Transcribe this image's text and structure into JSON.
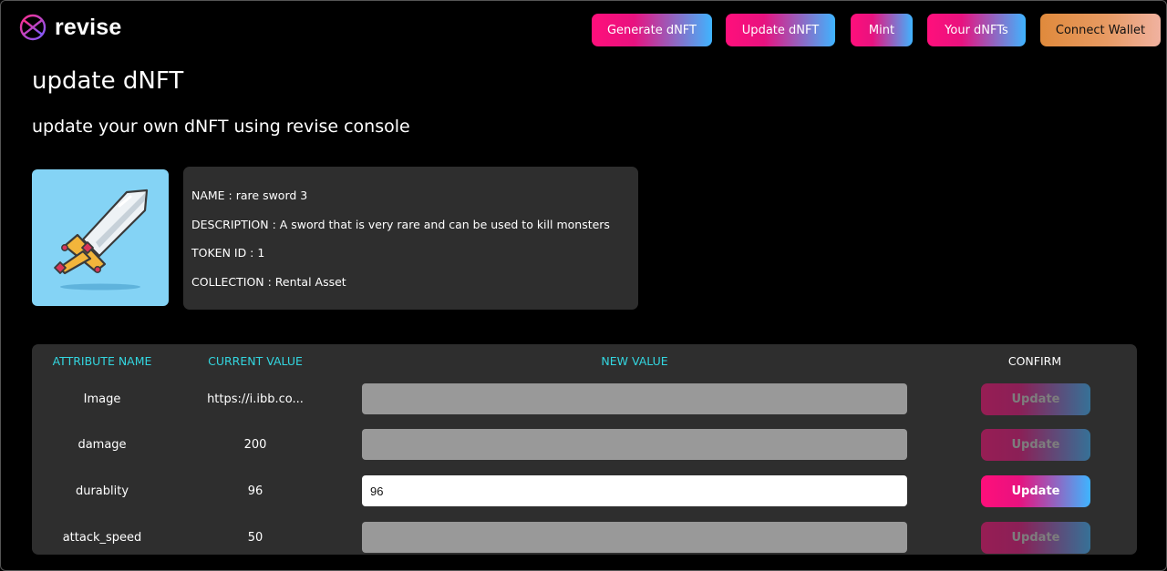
{
  "brand": {
    "name": "revise"
  },
  "nav": {
    "generate": "Generate dNFT",
    "update": "Update dNFT",
    "mint": "Mint",
    "your": "Your dNFTs",
    "wallet": "Connect Wallet"
  },
  "page": {
    "title": "update dNFT",
    "subtitle": "update your own dNFT using revise console"
  },
  "nft": {
    "image_icon": "sword-illustration",
    "image_bg": "#84d3f5",
    "name_line": "NAME : rare sword 3",
    "description_line": "DESCRIPTION : A sword that is very rare and can be used to kill monsters",
    "token_line": "TOKEN ID : 1",
    "collection_line": "COLLECTION : Rental Asset"
  },
  "table": {
    "headers": {
      "name": "ATTRIBUTE NAME",
      "current": "CURRENT VALUE",
      "new": "NEW VALUE",
      "confirm": "CONFIRM"
    },
    "rows": [
      {
        "name": "Image",
        "current": "https://i.ibb.co...",
        "new_value": "",
        "button": "Update",
        "enabled": false
      },
      {
        "name": "damage",
        "current": "200",
        "new_value": "",
        "button": "Update",
        "enabled": false
      },
      {
        "name": "durablity",
        "current": "96",
        "new_value": "96",
        "button": "Update",
        "enabled": true
      },
      {
        "name": "attack_speed",
        "current": "50",
        "new_value": "",
        "button": "Update",
        "enabled": false
      }
    ]
  },
  "colors": {
    "gradient_start": "#ff0f7b",
    "gradient_end": "#3fb4ff",
    "header_accent": "#33d6e0",
    "card_bg": "#2e2e2e"
  }
}
